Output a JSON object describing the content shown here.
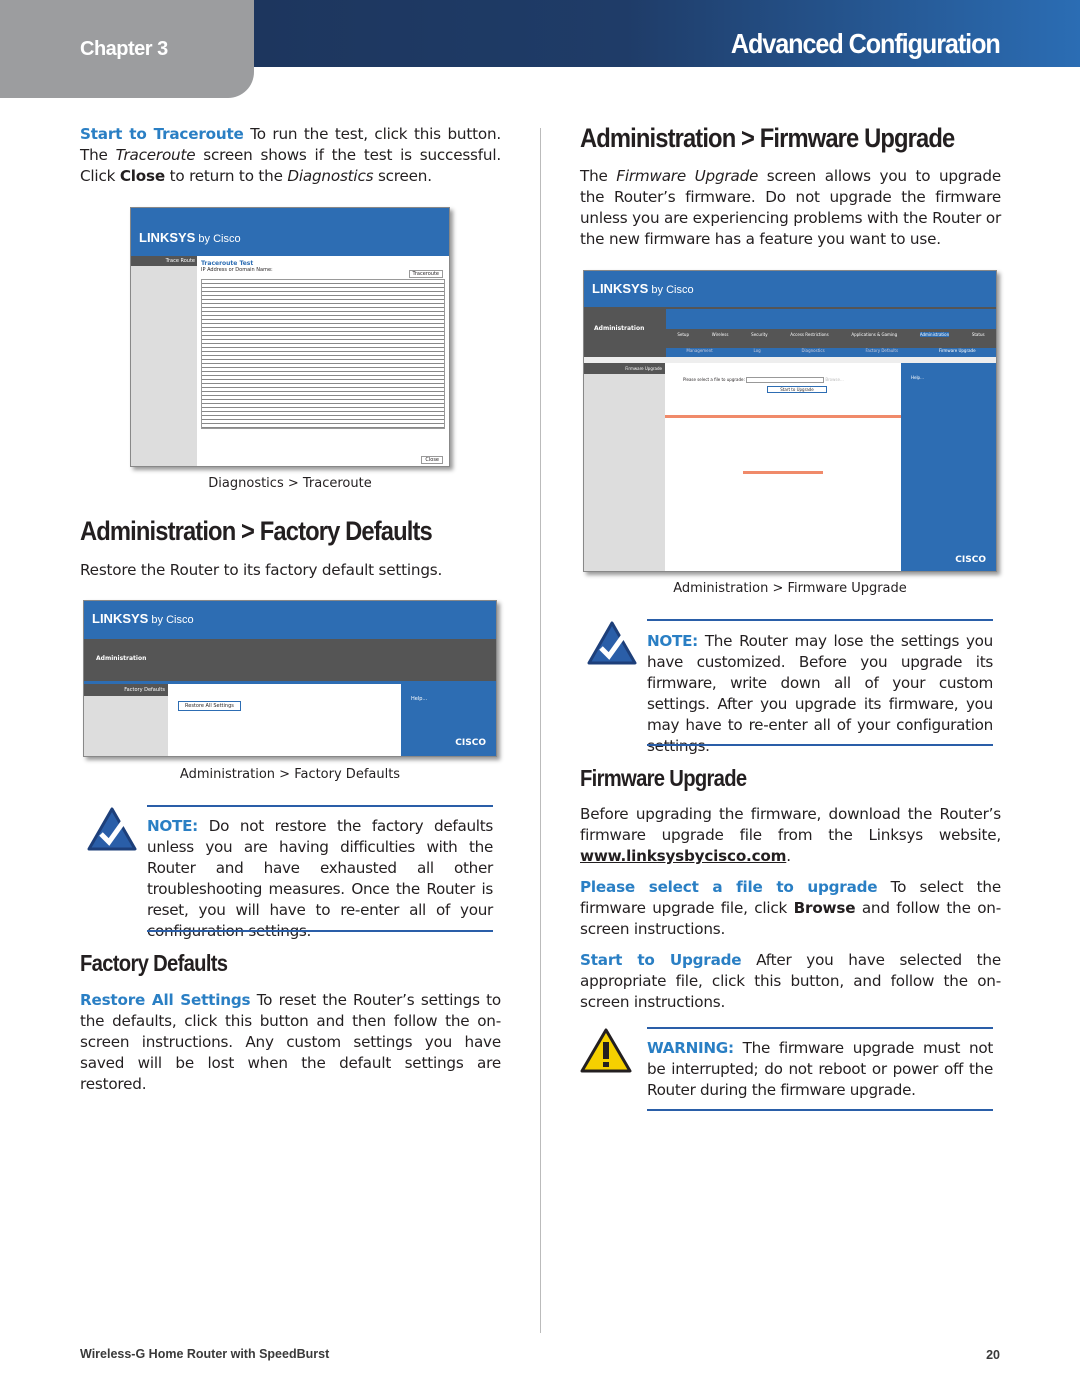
{
  "header": {
    "chapter": "Chapter 3",
    "section": "Advanced Configuration"
  },
  "left": {
    "traceroute_para": {
      "term": "Start to Traceroute",
      "t1": " To run the test, click this button. The ",
      "i1": "Traceroute",
      "t2": " screen shows if the test is successful. Click ",
      "b1": "Close",
      "t3": " to return to the ",
      "i2": "Diagnostics",
      "t4": " screen."
    },
    "shot1": {
      "logo": "LINKSYS",
      "by": " by Cisco",
      "side": "Trace Route",
      "title": "Traceroute Test",
      "field": "IP Address or Domain Name:",
      "button": "Traceroute",
      "close": "Close"
    },
    "caption1": "Diagnostics > Traceroute",
    "h_factory": "Administration > Factory Defaults",
    "factory_intro": "Restore the Router to its factory default settings.",
    "shot2": {
      "logo": "LINKSYS",
      "by": " by Cisco",
      "section": "Administration",
      "side": "Factory Defaults",
      "button": "Restore All Settings",
      "help": "Help...",
      "cisco": "CISCO"
    },
    "caption2": "Administration > Factory Defaults",
    "note": {
      "label": "NOTE:",
      "text": " Do not restore the factory defaults unless you are having difficulties with the Router and have exhausted all other troubleshooting measures. Once the Router is reset, you will have to re-enter all of your configuration settings."
    },
    "h_factory_sub": "Factory Defaults",
    "restore_para": {
      "term": "Restore All Settings",
      "text": "  To reset the Router’s settings to the defaults, click this button and then follow the on-screen instructions. Any custom settings you have saved will be lost when the default settings are restored."
    }
  },
  "right": {
    "h_firmware": "Administration > Firmware Upgrade",
    "intro": {
      "t1": "The ",
      "i1": "Firmware Upgrade",
      "t2": " screen allows you to upgrade the Router’s firmware. Do not upgrade the firmware unless you are experiencing problems with the Router or the new firmware has a feature you want to use."
    },
    "shot3": {
      "logo": "LINKSYS",
      "by": " by Cisco",
      "section": "Administration",
      "tabs": [
        "Setup",
        "Wireless",
        "Security",
        "Access Restrictions",
        "Applications & Gaming",
        "Administration",
        "Status"
      ],
      "subtabs": [
        "Management",
        "Log",
        "Diagnostics",
        "Factory Defaults",
        "Firmware Upgrade"
      ],
      "side": "Firmware Upgrade",
      "field": "Please select a file to upgrade:",
      "browse": "Browse...",
      "button": "Start to Upgrade",
      "help": "Help...",
      "cisco": "CISCO"
    },
    "caption3": "Administration > Firmware Upgrade",
    "note": {
      "label": "NOTE:",
      "text": " The Router may lose the settings you have customized. Before you upgrade its firmware, write down all of your custom settings. After you upgrade its firmware, you may have to re-enter all of your configuration settings."
    },
    "h_firmware_sub": "Firmware Upgrade",
    "before_para": {
      "text": "Before upgrading the firmware, download the Router’s firmware upgrade file from the Linksys website, ",
      "link": "www.linksysbycisco.com",
      "end": "."
    },
    "select_para": {
      "term": "Please select a file to upgrade",
      "t1": "  To select the firmware upgrade file, click ",
      "b1": "Browse",
      "t2": " and follow the on-screen instructions."
    },
    "start_para": {
      "term": "Start to Upgrade",
      "text": "  After you have selected the appropriate file, click this button, and follow the on-screen instructions."
    },
    "warning": {
      "label": "WARNING:",
      "text": " The firmware upgrade must not be interrupted; do not reboot or power off the Router during the firmware upgrade."
    }
  },
  "footer": {
    "product": "Wireless-G Home Router with SpeedBurst",
    "page": "20"
  },
  "colors": {
    "accent": "#2a7fc4",
    "header_dark": "#1d365e",
    "header_light": "#2b6db4",
    "tab_gray": "#9c9d9f"
  }
}
